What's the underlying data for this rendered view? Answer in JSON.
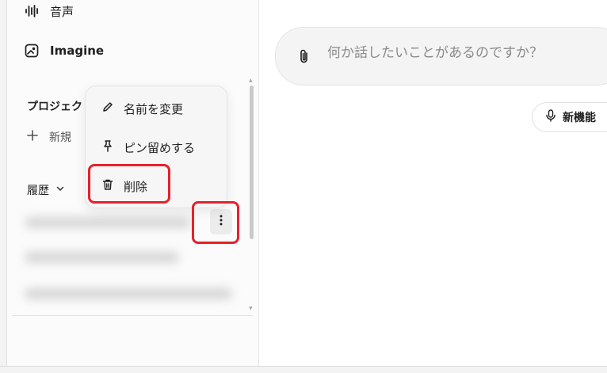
{
  "sidebar": {
    "nav": {
      "voice_label": "音声",
      "imagine_label": "Imagine"
    },
    "projects_title": "プロジェク",
    "new_project_label": "新規",
    "history_label": "履歴"
  },
  "context_menu": {
    "rename_label": "名前を変更",
    "pin_label": "ピン留めする",
    "delete_label": "削除"
  },
  "composer": {
    "placeholder": "何か話したいことがあるのですか？"
  },
  "new_feature_label": "新機能",
  "colors": {
    "highlight": "#e8202a",
    "sidebar_bg": "#fbfbfb",
    "composer_bg": "#f4f4f4"
  }
}
